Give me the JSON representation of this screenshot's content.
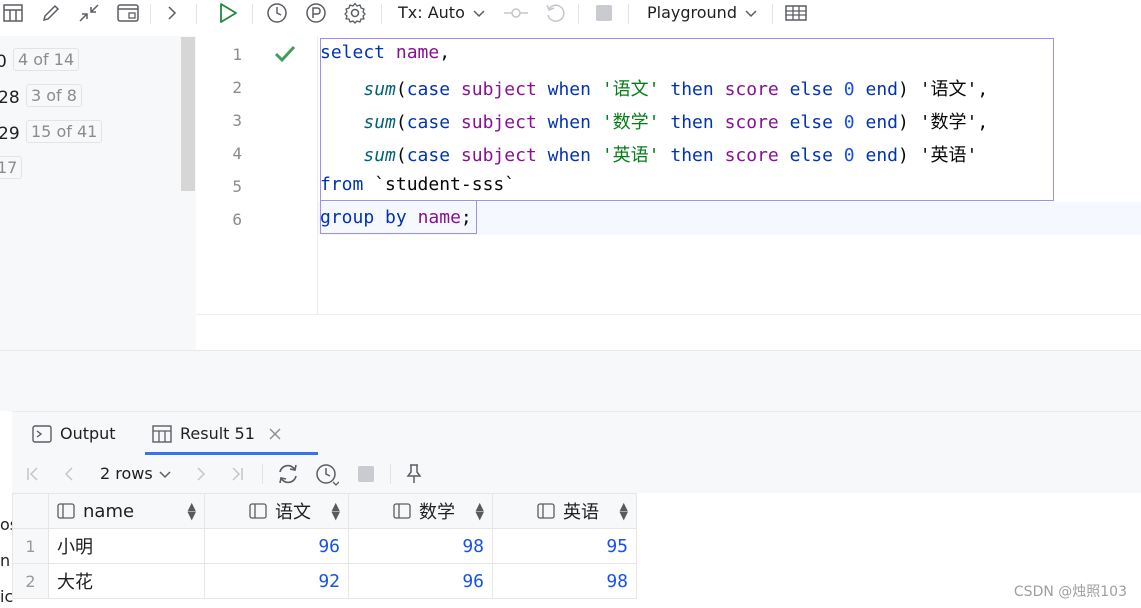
{
  "toolbar": {
    "tx_label": "Tx: Auto",
    "session_label": "Playground"
  },
  "left_panel": {
    "rows": [
      {
        "num": "0",
        "badge": "4 of 14"
      },
      {
        "num": "28",
        "badge": "3 of 8"
      },
      {
        "num": "29",
        "badge": "15 of 41"
      },
      {
        "num": "17",
        "badge": ""
      }
    ]
  },
  "editor": {
    "line_numbers": [
      "1",
      "2",
      "3",
      "4",
      "5",
      "6"
    ],
    "lines": {
      "l1": {
        "k1": "select",
        "c1": "name",
        "p1": ","
      },
      "l2": {
        "fn": "sum",
        "o": "(",
        "k1": "case",
        "c1": "subject",
        "k2": "when",
        "s1": "'语文'",
        "k3": "then",
        "c2": "score",
        "k4": "else",
        "n": "0",
        "k5": "end",
        "cl": ")",
        "alias": "'语文'",
        "p": ","
      },
      "l3": {
        "fn": "sum",
        "o": "(",
        "k1": "case",
        "c1": "subject",
        "k2": "when",
        "s1": "'数学'",
        "k3": "then",
        "c2": "score",
        "k4": "else",
        "n": "0",
        "k5": "end",
        "cl": ")",
        "alias": "'数学'",
        "p": ","
      },
      "l4": {
        "fn": "sum",
        "o": "(",
        "k1": "case",
        "c1": "subject",
        "k2": "when",
        "s1": "'英语'",
        "k3": "then",
        "c2": "score",
        "k4": "else",
        "n": "0",
        "k5": "end",
        "cl": ")",
        "alias": "'英语'"
      },
      "l5": {
        "k1": "from",
        "t": "`student-sss`"
      },
      "l6": {
        "k1": "group",
        "k2": "by",
        "c1": "name",
        "p": ";"
      }
    }
  },
  "tabs": {
    "output": "Output",
    "result": "Result 51"
  },
  "result_toolbar": {
    "rows_label": "2 rows"
  },
  "table": {
    "headers": [
      "name",
      "语文",
      "数学",
      "英语"
    ],
    "rows": [
      {
        "n": "1",
        "name": "小明",
        "yw": "96",
        "sx": "98",
        "yy": "95"
      },
      {
        "n": "2",
        "name": "大花",
        "yw": "92",
        "sx": "96",
        "yy": "98"
      }
    ]
  },
  "left_edge_text": [
    "os",
    "n",
    "ic"
  ],
  "watermark": "CSDN @烛照103",
  "colors": {
    "accent": "#3574f0",
    "run_green": "#208a3c",
    "selection": "#9f8ef0"
  }
}
